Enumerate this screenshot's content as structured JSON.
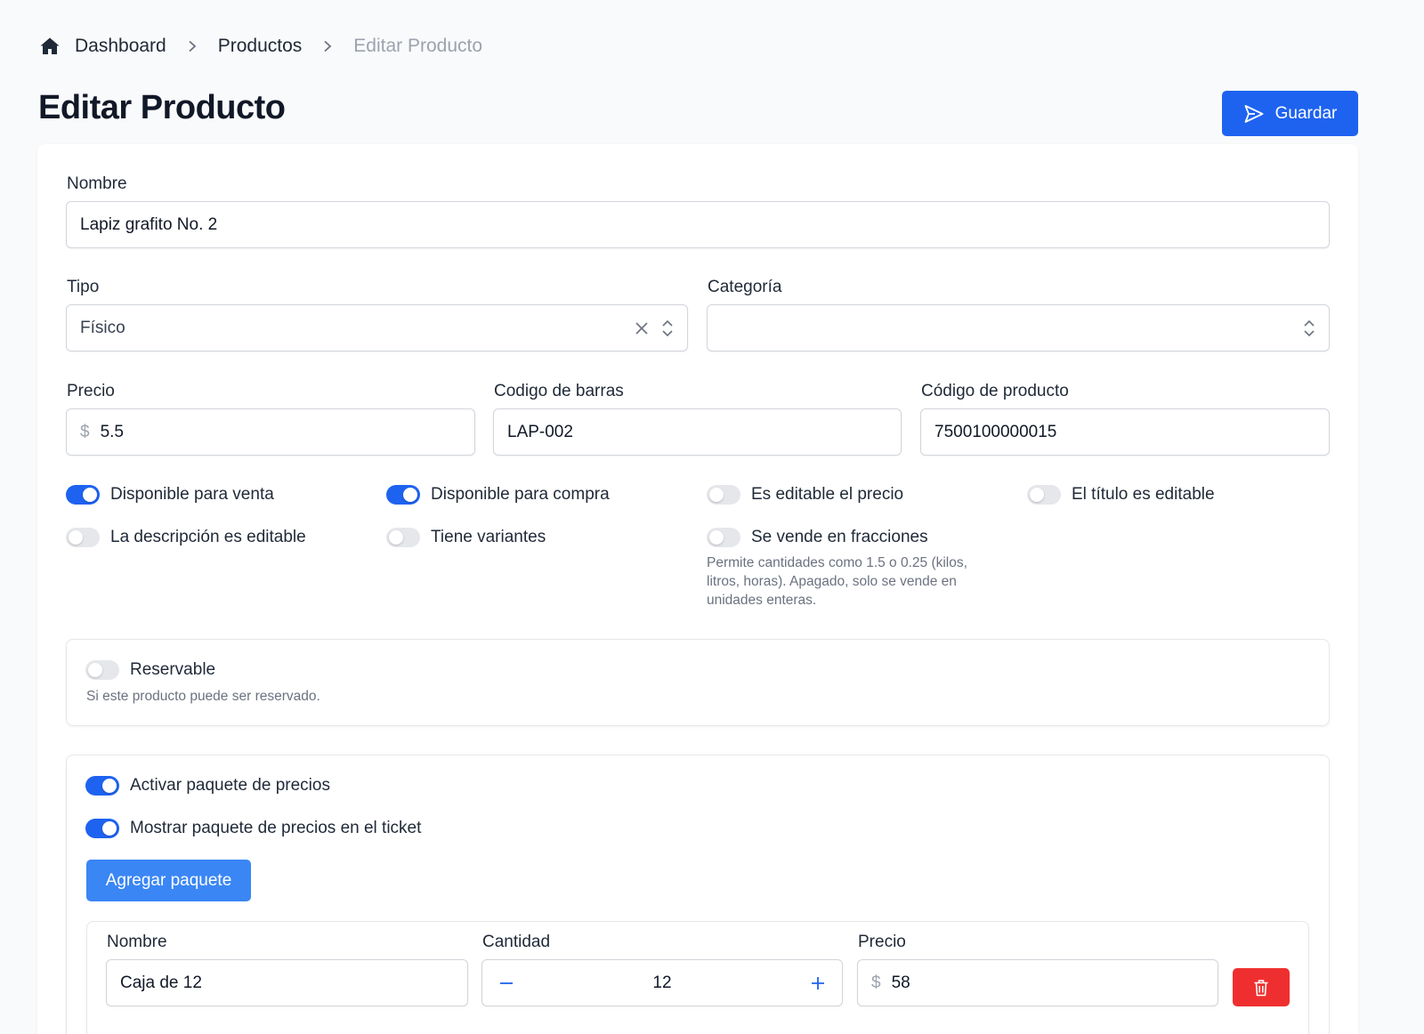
{
  "breadcrumb": {
    "items": [
      "Dashboard",
      "Productos",
      "Editar Producto"
    ]
  },
  "page": {
    "title": "Editar Producto",
    "save_label": "Guardar"
  },
  "form": {
    "nombre": {
      "label": "Nombre",
      "value": "Lapiz grafito No. 2"
    },
    "tipo": {
      "label": "Tipo",
      "value": "Físico"
    },
    "categoria": {
      "label": "Categoría",
      "value": ""
    },
    "precio": {
      "label": "Precio",
      "prefix": "$",
      "value": "5.5"
    },
    "codigo_barras": {
      "label": "Codigo de barras",
      "value": "LAP-002"
    },
    "codigo_producto": {
      "label": "Código de producto",
      "value": "7500100000015"
    }
  },
  "toggles": [
    {
      "label": "Disponible para venta",
      "on": true
    },
    {
      "label": "Disponible para compra",
      "on": true
    },
    {
      "label": "Es editable el precio",
      "on": false
    },
    {
      "label": "El título es editable",
      "on": false
    },
    {
      "label": "La descripción es editable",
      "on": false
    },
    {
      "label": "Tiene variantes",
      "on": false
    },
    {
      "label": "Se vende en fracciones",
      "on": false
    }
  ],
  "fracciones_help": "Permite cantidades como 1.5 o 0.25 (kilos, litros, horas). Apagado, solo se vende en unidades enteras.",
  "reservable": {
    "label": "Reservable",
    "on": false,
    "help": "Si este producto puede ser reservado."
  },
  "paquetes": {
    "activar": {
      "label": "Activar paquete de precios",
      "on": true
    },
    "mostrar": {
      "label": "Mostrar paquete de precios en el ticket",
      "on": true
    },
    "add_label": "Agregar paquete",
    "columns": {
      "nombre": "Nombre",
      "cantidad": "Cantidad",
      "precio": "Precio"
    },
    "rows": [
      {
        "nombre": "Caja de 12",
        "cantidad": "12",
        "precio_prefix": "$",
        "precio": "58"
      }
    ]
  },
  "colors": {
    "primary": "#1e63f0",
    "danger": "#ef2f2f",
    "switch_off": "#e5e7eb"
  }
}
